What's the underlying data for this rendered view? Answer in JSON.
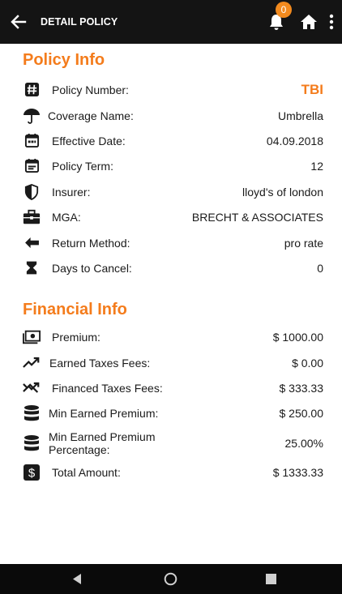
{
  "appbar": {
    "title": "DETAIL POLICY",
    "notification_count": "0"
  },
  "policy_info": {
    "title": "Policy Info",
    "rows": [
      {
        "icon": "hash-icon",
        "label": "Policy Number:",
        "value": "TBI"
      },
      {
        "icon": "umbrella-icon",
        "label": "Coverage Name:",
        "value": "Umbrella"
      },
      {
        "icon": "calendar-icon",
        "label": "Effective Date:",
        "value": "04.09.2018"
      },
      {
        "icon": "calendar-text-icon",
        "label": "Policy Term:",
        "value": "12"
      },
      {
        "icon": "shield-icon",
        "label": "Insurer:",
        "value": "lloyd's of london"
      },
      {
        "icon": "briefcase-icon",
        "label": "MGA:",
        "value": "BRECHT & ASSOCIATES"
      },
      {
        "icon": "arrow-left-icon",
        "label": "Return Method:",
        "value": "pro rate"
      },
      {
        "icon": "hourglass-icon",
        "label": "Days to Cancel:",
        "value": "0"
      }
    ]
  },
  "financial_info": {
    "title": "Financial Info",
    "rows": [
      {
        "icon": "money-icon",
        "label": "Premium:",
        "value": "$ 1000.00"
      },
      {
        "icon": "trending-up-icon",
        "label": "Earned Taxes Fees:",
        "value": "$ 0.00"
      },
      {
        "icon": "trending-down-icon",
        "label": "Financed Taxes Fees:",
        "value": "$ 333.33"
      },
      {
        "icon": "database-icon",
        "label": "Min Earned Premium:",
        "value": "$ 250.00"
      },
      {
        "icon": "database-icon",
        "label_line1": "Min Earned Premium",
        "label_line2": "Percentage:",
        "value": "25.00%"
      },
      {
        "icon": "dollar-box-icon",
        "label": "Total Amount:",
        "value": "$ 1333.33"
      }
    ]
  },
  "colors": {
    "accent": "#f47c1c",
    "appbar": "#141414",
    "badge": "#f28a1e"
  }
}
